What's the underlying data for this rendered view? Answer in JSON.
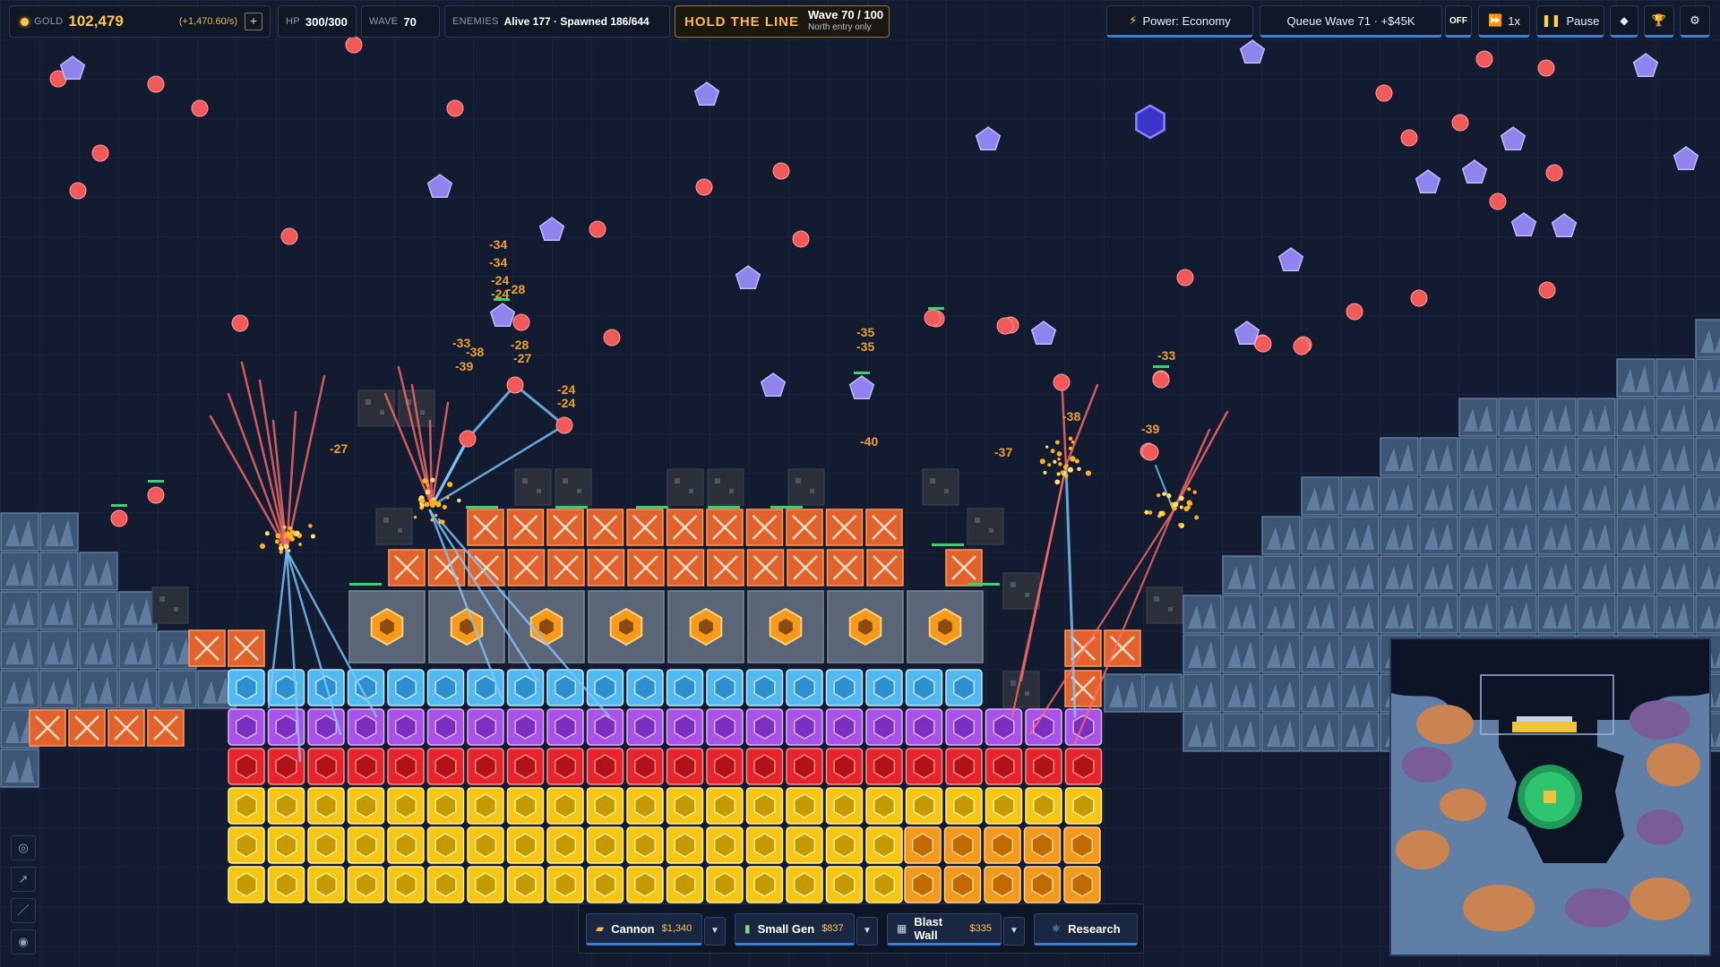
{
  "hud": {
    "gold_label": "GOLD",
    "gold_value": "102,479",
    "gold_rate": "(+1,470.60/s)",
    "gold_add": "+",
    "hp_label": "HP",
    "hp_value": "300/300",
    "wave_label": "WAVE",
    "wave_value": "70",
    "enemies_label": "ENEMIES",
    "enemies_value": "Alive 177 · Spawned 186/644",
    "banner_title": "HOLD THE LINE",
    "banner_wave": "Wave 70 / 100",
    "banner_sub": "North entry only"
  },
  "controls": {
    "power_label": "Power: Economy",
    "queue_label": "Queue Wave 71 · +$45K",
    "auto_label": "OFF",
    "speed_label": "1x",
    "pause_label": "Pause"
  },
  "icons": {
    "power": "lightning-icon",
    "speed": "fast-forward-icon",
    "pause": "pause-icon",
    "diamond": "diamond-icon",
    "trophy": "trophy-icon",
    "settings": "gear-icon"
  },
  "build": {
    "items": [
      {
        "label": "Cannon",
        "price": "$1,340"
      },
      {
        "label": "Small Gen",
        "price": "$837"
      },
      {
        "label": "Blast Wall",
        "price": "$335"
      }
    ],
    "research_label": "Research"
  },
  "damage_numbers": [
    "-34",
    "-34",
    "-24",
    "-24",
    "-28",
    "-33",
    "-38",
    "-39",
    "-28",
    "-27",
    "-24",
    "-24",
    "-35",
    "-35",
    "-33",
    "-39",
    "-38",
    "-40",
    "-37",
    "-27"
  ],
  "colors": {
    "gold": "#ffc54a",
    "accent_blue": "#3d7fd1",
    "banner_orange": "#ffb84a",
    "enemy_red": "#f25a5a",
    "enemy_purple": "#8f84ee",
    "wall_orange": "#e2622e",
    "armor_cyan": "#4fb9f0",
    "armor_purple": "#a852e8",
    "armor_red": "#e7242c",
    "armor_yellow": "#f6c612"
  }
}
